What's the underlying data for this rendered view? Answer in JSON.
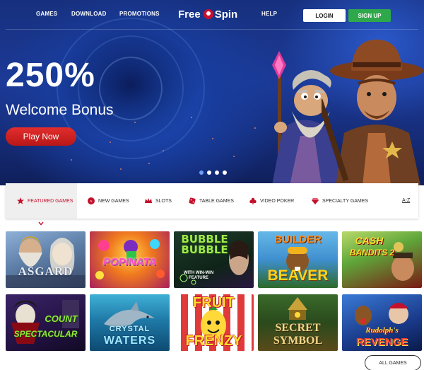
{
  "nav": {
    "games": "GAMES",
    "download": "DOWNLOAD",
    "promotions": "PROMOTIONS",
    "brand_left": "Free",
    "brand_right": "Spin",
    "help": "HELP",
    "login": "LOGIN",
    "signup": "SIGN UP"
  },
  "hero": {
    "amount": "250%",
    "label": "Welcome Bonus",
    "cta": "Play Now",
    "slide_count": 4,
    "active_slide": 1
  },
  "categories": {
    "featured": "FEATURED GAMES",
    "new": "NEW GAMES",
    "slots": "SLOTS",
    "table": "TABLE GAMES",
    "video_poker": "VIDEO POKER",
    "specialty": "SPECIALTY GAMES",
    "az": "A-Z"
  },
  "games": [
    {
      "title": "ASGARD"
    },
    {
      "title": "POPINATA"
    },
    {
      "title": "BUBBLE BUBBLE"
    },
    {
      "title_line1": "BUILDER",
      "title_line2": "BEAVER"
    },
    {
      "title_line1": "CASH",
      "title_line2": "BANDITS 2"
    },
    {
      "title_line1": "COUNT",
      "title_line2": "SPECTACULAR"
    },
    {
      "title_line1": "CRYSTAL",
      "title_line2": "WATERS"
    },
    {
      "title_line1": "FRUIT",
      "title_line2": "FRENZY"
    },
    {
      "title_line1": "SECRET",
      "title_line2": "SYMBOL"
    },
    {
      "title_line1": "Rudolph's",
      "title_line2": "REVENGE"
    }
  ],
  "bubble_badge": "WITH WIN-WIN FEATURE",
  "all_games": "ALL GAMES",
  "colors": {
    "accent_red": "#c4102b",
    "signup_green": "#2ea84a",
    "hero_blue": "#1c3a97"
  }
}
